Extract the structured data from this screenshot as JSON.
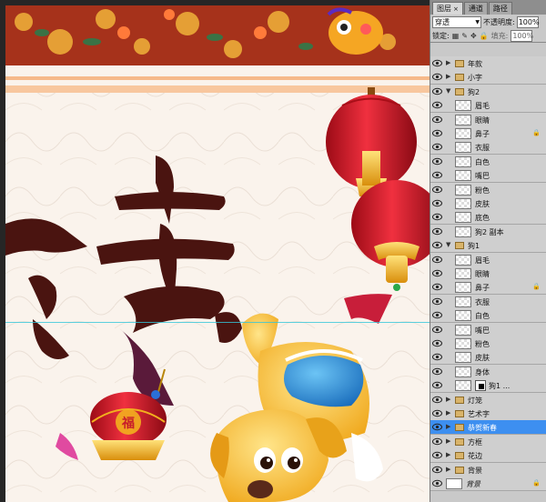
{
  "layers_panel": {
    "tabs": [
      {
        "label": "图层",
        "active": true
      },
      {
        "label": "通道",
        "active": false
      },
      {
        "label": "路径",
        "active": false
      }
    ],
    "blend_mode": "穿透",
    "opacity_label": "不透明度:",
    "opacity_value": "100%",
    "lock_label": "锁定:",
    "fill_label": "填充:",
    "fill_value": "100%",
    "layers": [
      {
        "name": "年款",
        "type": "group",
        "expanded": false,
        "indent": 0,
        "locked": false,
        "selected": false
      },
      {
        "name": "小字",
        "type": "group",
        "expanded": false,
        "indent": 0,
        "locked": false,
        "selected": false
      },
      {
        "name": "狗2",
        "type": "group",
        "expanded": true,
        "indent": 0,
        "locked": false,
        "selected": false
      },
      {
        "name": "眉毛",
        "type": "layer",
        "indent": 1,
        "locked": false,
        "selected": false
      },
      {
        "name": "眼睛",
        "type": "layer",
        "indent": 1,
        "locked": false,
        "selected": false
      },
      {
        "name": "鼻子",
        "type": "layer",
        "indent": 1,
        "locked": true,
        "selected": false
      },
      {
        "name": "衣服",
        "type": "layer",
        "indent": 1,
        "locked": false,
        "selected": false
      },
      {
        "name": "白色",
        "type": "layer",
        "indent": 1,
        "locked": false,
        "selected": false
      },
      {
        "name": "嘴巴",
        "type": "layer",
        "indent": 1,
        "locked": false,
        "selected": false
      },
      {
        "name": "粉色",
        "type": "layer",
        "indent": 1,
        "locked": false,
        "selected": false
      },
      {
        "name": "皮肤",
        "type": "layer",
        "indent": 1,
        "locked": false,
        "selected": false
      },
      {
        "name": "底色",
        "type": "layer",
        "indent": 1,
        "locked": false,
        "selected": false
      },
      {
        "name": "狗2 副本",
        "type": "layer",
        "indent": 1,
        "locked": false,
        "selected": false
      },
      {
        "name": "狗1",
        "type": "group",
        "expanded": true,
        "indent": 0,
        "locked": false,
        "selected": false
      },
      {
        "name": "眉毛",
        "type": "layer",
        "indent": 1,
        "locked": false,
        "selected": false
      },
      {
        "name": "眼睛",
        "type": "layer",
        "indent": 1,
        "locked": false,
        "selected": false
      },
      {
        "name": "鼻子",
        "type": "layer",
        "indent": 1,
        "locked": true,
        "selected": false
      },
      {
        "name": "衣服",
        "type": "layer",
        "indent": 1,
        "locked": false,
        "selected": false
      },
      {
        "name": "白色",
        "type": "layer",
        "indent": 1,
        "locked": false,
        "selected": false
      },
      {
        "name": "嘴巴",
        "type": "layer",
        "indent": 1,
        "locked": false,
        "selected": false
      },
      {
        "name": "粉色",
        "type": "layer",
        "indent": 1,
        "locked": false,
        "selected": false
      },
      {
        "name": "皮肤",
        "type": "layer",
        "indent": 1,
        "locked": false,
        "selected": false
      },
      {
        "name": "身体",
        "type": "layer",
        "indent": 1,
        "locked": false,
        "selected": false
      },
      {
        "name": "狗1 ...",
        "type": "masked",
        "indent": 1,
        "locked": false,
        "selected": false
      },
      {
        "name": "灯笼",
        "type": "group",
        "expanded": false,
        "indent": 0,
        "locked": false,
        "selected": false
      },
      {
        "name": "艺术字",
        "type": "group",
        "expanded": false,
        "indent": 0,
        "locked": false,
        "selected": false
      },
      {
        "name": "恭贺新春",
        "type": "group",
        "expanded": false,
        "indent": 0,
        "locked": false,
        "selected": true
      },
      {
        "name": "方框",
        "type": "group",
        "expanded": false,
        "indent": 0,
        "locked": false,
        "selected": false
      },
      {
        "name": "花边",
        "type": "group",
        "expanded": false,
        "indent": 0,
        "locked": false,
        "selected": false
      },
      {
        "name": "背景",
        "type": "group",
        "expanded": false,
        "indent": 0,
        "locked": false,
        "selected": false
      },
      {
        "name": "背景",
        "type": "background",
        "indent": 0,
        "locked": true,
        "selected": false
      }
    ]
  },
  "canvas": {
    "lantern_character": "福",
    "colors": {
      "border": "#8a1e14",
      "lantern_red": "#d81e2a",
      "gold": "#f2b01e",
      "dog_yellow": "#f6c441",
      "dog_coat": "#2a8fd8",
      "calligraphy": "#4a1410",
      "guide": "#33c6d9",
      "selection": "#3d8ff0"
    }
  }
}
